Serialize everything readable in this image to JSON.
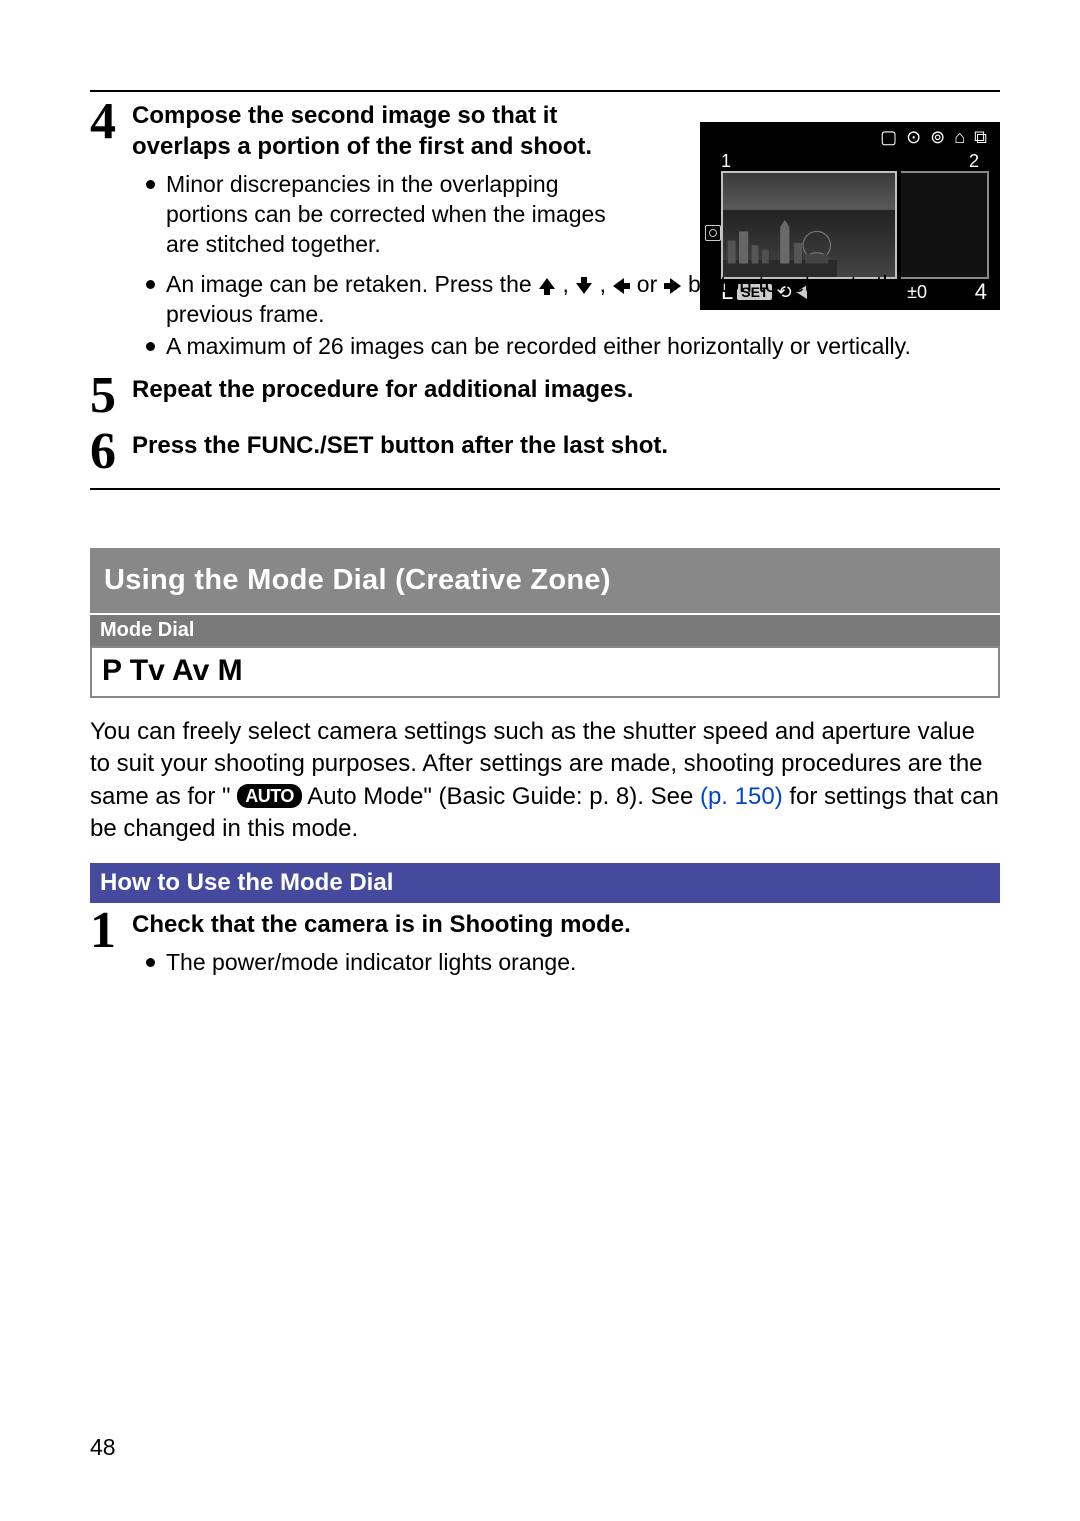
{
  "step4": {
    "num": "4",
    "title": "Compose the second image so that it overlaps a portion of the first and shoot.",
    "b1": "Minor discrepancies in the overlapping portions can be corrected when the images are stitched together.",
    "b2a": "An image can be retaken. Press the ",
    "b2b": " , ",
    "b2c": " , ",
    "b2d": " or ",
    "b2e": " button to return to the previous frame.",
    "b3": "A maximum of 26 images can be recorded either horizontally or vertically."
  },
  "lcd": {
    "topIcons": "▢ ⊙ ⊚ ⌂ ⧉",
    "n1": "1",
    "n2": "2",
    "set": "SET",
    "undo": "⟲",
    "ev": "±0",
    "count": "4",
    "l": "L"
  },
  "step5": {
    "num": "5",
    "title": "Repeat the procedure for additional images."
  },
  "step6": {
    "num": "6",
    "title": "Press the FUNC./SET button after the last shot."
  },
  "section": "Using the Mode Dial (Creative Zone)",
  "modeDialLabel": "Mode Dial",
  "modes": "P Tv Av M",
  "para1": "You can freely select camera settings such as the shutter speed and aperture value to suit your shooting purposes. After settings are made, shooting procedures are the same as for \" ",
  "autoPill": "AUTO",
  "para2": "Auto Mode\" (Basic Guide: p. 8). See ",
  "pageref": "(p. 150)",
  "para3": " for settings that can be changed in this mode.",
  "howTo": "How to Use the Mode Dial",
  "step1": {
    "num": "1",
    "title": "Check that the camera is in Shooting mode.",
    "b1": "The power/mode indicator lights orange."
  },
  "pageNum": "48"
}
